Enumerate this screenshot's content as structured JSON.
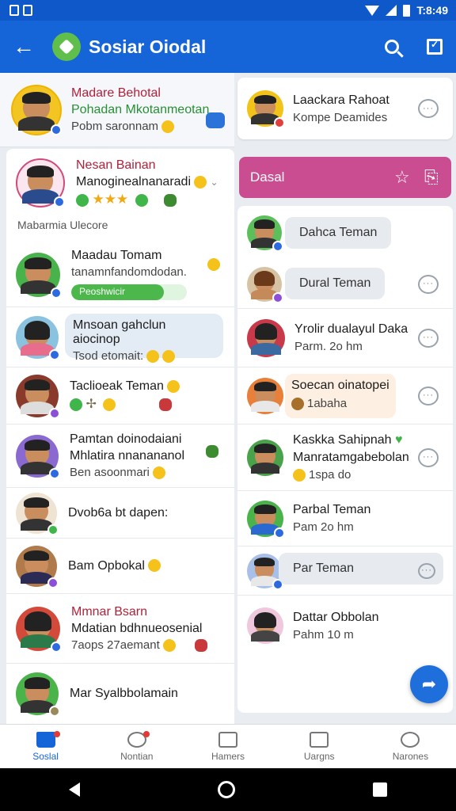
{
  "status_bar": {
    "time": "T:8:49"
  },
  "app_bar": {
    "title": "Sosiar Oiodal"
  },
  "top_left": {
    "name": "Madare Behotal",
    "subtitle": "Pohadan Mkotanmeotan",
    "status": "Pobm saronnam"
  },
  "top_right": {
    "name": "Laackara Rahoat",
    "subtitle": "Kompe Deamides"
  },
  "left_list": {
    "featured": {
      "name": "Nesan Bainan",
      "subtitle": "Manoginealnanaradi"
    },
    "ticker": "Mabarmia Ulecore",
    "rows": [
      {
        "name": "Maadau Tomam",
        "sub": "tanamnfandomdodan.",
        "tag": "Peoshwicir",
        "progress": 0.8
      },
      {
        "name": "Mnsoan gahclun aiocinop",
        "sub": "Tsod etomait:"
      },
      {
        "name": "Taclioeak Teman",
        "sub": ""
      },
      {
        "name": "Pamtan doinodaiani",
        "sub": "Mhlatira nnanananol",
        "extra": "Ben asoonmari"
      },
      {
        "name": "Dvob6a bt dapen:",
        "sub": ""
      },
      {
        "name": "Bam Opbokal",
        "sub": ""
      },
      {
        "name": "Mmnar Bsarn",
        "sub": "Mdatian bdhnueosenial",
        "extra": "7aops 27aemant"
      },
      {
        "name": "Mar Syalbbolamain",
        "sub": ""
      }
    ]
  },
  "dasal_header": {
    "title": "Dasal"
  },
  "right_list": {
    "rows": [
      {
        "name": "Dahca Teman"
      },
      {
        "name": "Dural Teman"
      },
      {
        "name": "Yrolir dualayul Daka",
        "sub": "Parm. 2o hm"
      },
      {
        "name": "Soecan oinatopei",
        "sub": "1abaha"
      },
      {
        "name": "Kaskka Sahipnah",
        "sub": "Manratamgabebolan",
        "extra": "1spa do"
      },
      {
        "name": "Parbal Teman",
        "sub": "Pam 2o hm"
      },
      {
        "name": "Par Teman"
      },
      {
        "name": "Dattar Obbolan",
        "sub": "Pahm 10 m"
      }
    ]
  },
  "bottom_nav": [
    "Soslal",
    "Nontian",
    "Hamers",
    "Uargns",
    "Narones"
  ],
  "colors": {
    "primary": "#1565d8",
    "accent_pink": "#c94d90",
    "online_green": "#3fb54a"
  }
}
